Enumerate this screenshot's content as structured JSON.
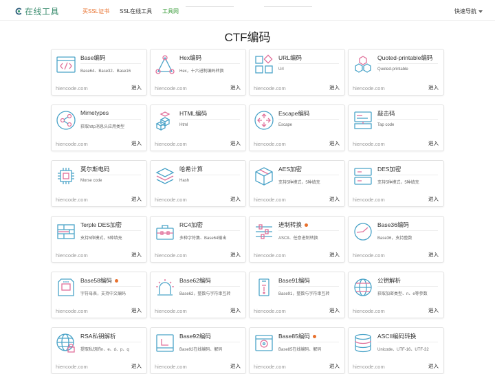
{
  "header": {
    "logo_text": "在线工具",
    "nav_ssl_cert": "买SSL证书",
    "nav_ssl_tool": "SSL在线工具",
    "nav_tool_net": "工具网",
    "quick_nav": "快速导航"
  },
  "page_title": "CTF编码",
  "cards": [
    {
      "name": "Base编码",
      "desc": "Base64、Base32、Base16",
      "site": "hiencode.com",
      "enter": "进入",
      "icon": "code-window-icon"
    },
    {
      "name": "Hex编码",
      "desc": "Hex，十六进制编码转换",
      "site": "hiencode.com",
      "enter": "进入",
      "icon": "triangle-nodes-icon"
    },
    {
      "name": "URL编码",
      "desc": "Url",
      "site": "hiencode.com",
      "enter": "进入",
      "icon": "shapes-grid-icon"
    },
    {
      "name": "Quoted-printable编码",
      "desc": "Quoted-printable",
      "site": "hiencode.com",
      "enter": "进入",
      "icon": "hexagon-cluster-icon"
    },
    {
      "name": "Mimetypes",
      "desc": "获取http消息头应用类型",
      "site": "hiencode.com",
      "enter": "进入",
      "icon": "share-circle-icon"
    },
    {
      "name": "HTML编码",
      "desc": "Html",
      "site": "hiencode.com",
      "enter": "进入",
      "icon": "cubes-icon"
    },
    {
      "name": "Escape编码",
      "desc": "Escape",
      "site": "hiencode.com",
      "enter": "进入",
      "icon": "arrows-circle-icon"
    },
    {
      "name": "敲击码",
      "desc": "Tap code",
      "site": "hiencode.com",
      "enter": "进入",
      "icon": "server-monitor-icon"
    },
    {
      "name": "莫尔斯电码",
      "desc": "Morse code",
      "site": "hiencode.com",
      "enter": "进入",
      "icon": "chip-icon"
    },
    {
      "name": "哈希计算",
      "desc": "Hash",
      "site": "hiencode.com",
      "enter": "进入",
      "icon": "layers-icon"
    },
    {
      "name": "AES加密",
      "desc": "支持5种模式，5种填充",
      "site": "hiencode.com",
      "enter": "进入",
      "icon": "cube-icon"
    },
    {
      "name": "DES加密",
      "desc": "支持5种模式，5种填充",
      "site": "hiencode.com",
      "enter": "进入",
      "icon": "server-rack-icon"
    },
    {
      "name": "Terple DES加密",
      "desc": "支持5种模式，5种填充",
      "site": "hiencode.com",
      "enter": "进入",
      "icon": "brick-wall-icon"
    },
    {
      "name": "RC4加密",
      "desc": "多种字符集、Base64输出",
      "site": "hiencode.com",
      "enter": "进入",
      "icon": "toolbox-icon"
    },
    {
      "name": "进制转换",
      "desc": "ASCII、任意进制转换",
      "site": "hiencode.com",
      "enter": "进入",
      "icon": "sliders-icon",
      "hot": true
    },
    {
      "name": "Base36编码",
      "desc": "Base36，支持整数",
      "site": "hiencode.com",
      "enter": "进入",
      "icon": "gauge-icon"
    },
    {
      "name": "Base58编码",
      "desc": "字符母表，支持中文编码",
      "site": "hiencode.com",
      "enter": "进入",
      "icon": "sd-card-icon",
      "hot": true
    },
    {
      "name": "Base62编码",
      "desc": "Base62，整数与字符串互转",
      "site": "hiencode.com",
      "enter": "进入",
      "icon": "alarm-light-icon"
    },
    {
      "name": "Base91编码",
      "desc": "Base91，整数与字符串互转",
      "site": "hiencode.com",
      "enter": "进入",
      "icon": "phone-panel-icon"
    },
    {
      "name": "公钥解析",
      "desc": "获取加密类型、n、e等参数",
      "site": "hiencode.com",
      "enter": "进入",
      "icon": "globe-icon"
    },
    {
      "name": "RSA私钥解析",
      "desc": "提取私钥的n、e、d、p、q",
      "site": "hiencode.com",
      "enter": "进入",
      "icon": "globe-lock-icon"
    },
    {
      "name": "Base92编码",
      "desc": "Base92在线编码、解码",
      "site": "hiencode.com",
      "enter": "进入",
      "icon": "clock-frame-icon"
    },
    {
      "name": "Base85编码",
      "desc": "Base85在线编码、解码",
      "site": "hiencode.com",
      "enter": "进入",
      "icon": "disc-window-icon",
      "hot": true
    },
    {
      "name": "ASCII编码转换",
      "desc": "Unicode、UTF-16、UTF-32",
      "site": "hiencode.com",
      "enter": "进入",
      "icon": "database-icon"
    }
  ],
  "colors": {
    "accent_blue": "#4aa3c8",
    "accent_pink": "#e0709a",
    "hot_dot": "#e8712e"
  }
}
